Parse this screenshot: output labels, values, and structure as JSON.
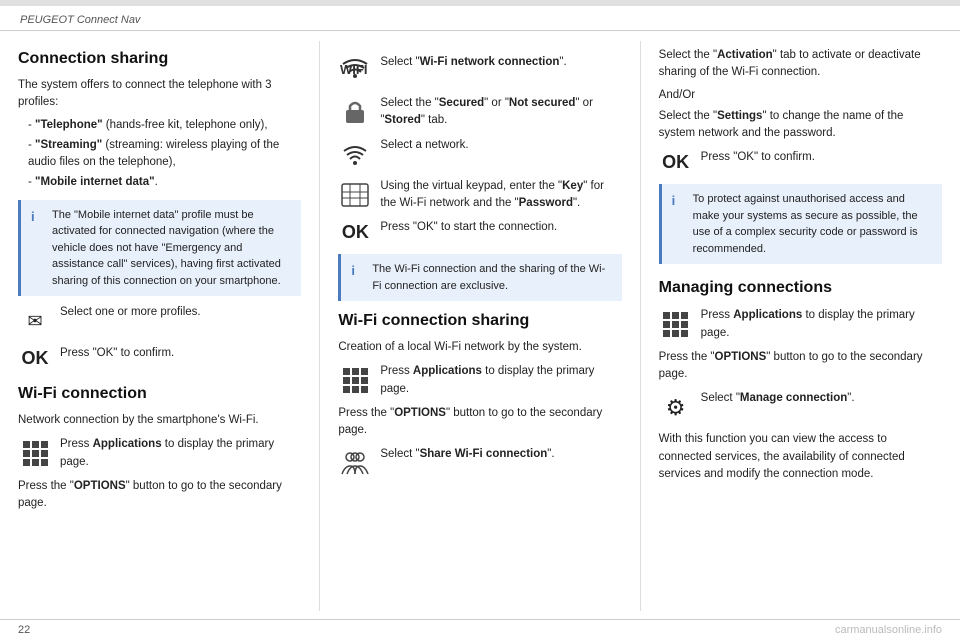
{
  "header": {
    "title": "PEUGEOT Connect Nav"
  },
  "page_number": "22",
  "watermark": "carmanualsonline.info",
  "col1": {
    "section1_title": "Connection sharing",
    "section1_intro": "The system offers to connect the telephone with 3 profiles:",
    "profiles": [
      {
        "label": "\"Telephone\"",
        "desc": "(hands-free kit, telephone only),"
      },
      {
        "label": "\"Streaming\"",
        "desc": "(streaming: wireless playing of the audio files on the telephone),"
      },
      {
        "label": "\"Mobile internet data\"",
        "desc": "."
      }
    ],
    "info_box": {
      "icon": "i",
      "text": "The \"Mobile internet data\" profile must be activated for connected navigation (where the vehicle does not have \"Emergency and assistance call\" services), having first activated sharing of this connection on your smartphone."
    },
    "step1_text": "Select one or more profiles.",
    "step2_text": "Press \"OK\" to confirm.",
    "section2_title": "Wi-Fi connection",
    "section2_intro": "Network connection by the smartphone's Wi-Fi.",
    "wifi_step1": "Press Applications to display the primary page.",
    "wifi_press_options": "Press the \"OPTIONS\" button to go to the secondary page."
  },
  "col2": {
    "wifi_label": "WIFI",
    "step_wifi_network": "Select \"Wi-Fi network connection\".",
    "step_secured": "Select the \"Secured\" or \"Not secured\" or \"Stored\" tab.",
    "step_network": "Select a network.",
    "step_keypad": "Using the virtual keypad, enter the \"Key\" for the Wi-Fi network and the \"Password\".",
    "step_ok": "Press \"OK\" to start the connection.",
    "info_box": {
      "icon": "i",
      "text": "The Wi-Fi connection and the sharing of the Wi-Fi connection are exclusive."
    },
    "section_title": "Wi-Fi connection sharing",
    "section_intro": "Creation of a local Wi-Fi network by the system.",
    "step_apps": "Press Applications to display the primary page.",
    "press_options": "Press the \"OPTIONS\" button to go to the secondary page.",
    "select_share": "Select \"Share Wi-Fi connection\"."
  },
  "col3": {
    "step_activation": "Select the \"Activation\" tab to activate or deactivate sharing of the Wi-Fi connection.",
    "and_or": "And/Or",
    "step_settings": "Select the \"Settings\" to change the name of the system network and the password.",
    "ok_confirm": "Press \"OK\" to confirm.",
    "info_box": {
      "icon": "i",
      "text": "To protect against unauthorised access and make your systems as secure as possible, the use of a complex security code or password is recommended."
    },
    "section_title": "Managing connections",
    "step_apps": "Press Applications to display the primary page.",
    "press_options": "Press the \"OPTIONS\" button to go to the secondary page.",
    "select_manage": "Select \"Manage connection\".",
    "description": "With this function you can view the access to connected services, the availability of connected services and modify the connection mode."
  }
}
